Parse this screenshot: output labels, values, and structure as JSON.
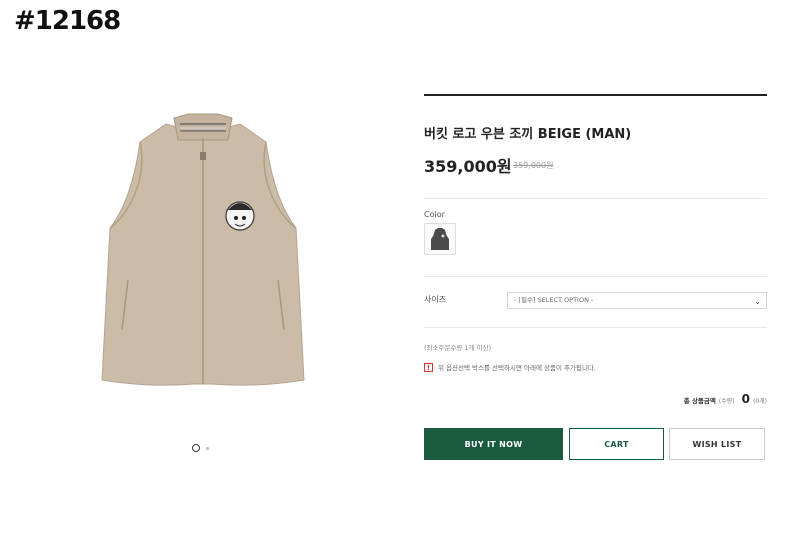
{
  "tag": "#12168",
  "product": {
    "title": "버킷 로고 우븐 조끼 BEIGE (MAN)",
    "price": "359,000원",
    "original_price": "359,000원"
  },
  "color": {
    "label": "Color"
  },
  "size": {
    "label": "사이즈",
    "selected": "- [필수] SELECT OPTION -"
  },
  "min_qty": "(최소주문수량 1개 이상)",
  "notice": "위 옵션선택 박스를 선택하시면 아래에 상품이 추가됩니다.",
  "total": {
    "label": "총 상품금액",
    "qty_label": "(수량)",
    "amount": "0",
    "count": "(0개)"
  },
  "buttons": {
    "buy": "BUY IT NOW",
    "cart": "CART",
    "wish": "WISH LIST"
  },
  "gallery": {
    "slide_count": 2,
    "active_slide": 1
  },
  "colors": {
    "accent": "#1a5b3f",
    "vest": "#c9b9a5"
  }
}
